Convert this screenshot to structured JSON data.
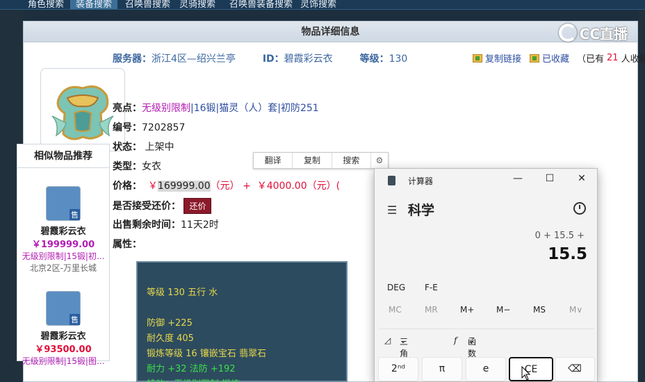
{
  "nav": {
    "tabs": [
      "角色搜索",
      "装备搜索",
      "召唤兽搜索",
      "灵骑搜索",
      "召唤兽装备搜索",
      "灵饰搜索"
    ],
    "active_index": 1
  },
  "panel": {
    "title": "物品详细信息",
    "logo_text": "CC直播"
  },
  "item": {
    "server_label": "服务器：",
    "server_value": "浙江4区—绍兴兰亭",
    "id_label": "ID：",
    "id_value": "碧霞彩云衣",
    "level_label": "等级：",
    "level_value": "130",
    "copy_link": "复制链接",
    "favorited": "已收藏",
    "fav_prefix": "（已有",
    "fav_count": "21",
    "fav_suffix": "人收藏）",
    "highlight_label": "亮点：",
    "highlight_1": "无级别限制",
    "highlight_2": "|16锻|猫灵（人）套|初防251",
    "serial_label": "编号：",
    "serial_value": "7202857",
    "status_label": "状态：",
    "status_value": "上架中",
    "type_label": "类型：",
    "type_value": "女衣",
    "price_label": "价格：",
    "price_value_selected": "￥169999.00",
    "price_unit": "（元）",
    "price_plus": "+",
    "price_extra": "￥4000.00（元）(",
    "bargain_label": "是否接受还价：",
    "bargain_button": "还价",
    "remaining_label": "出售剩余时间：",
    "remaining_value": "11天2时",
    "attr_label": "属性："
  },
  "context_menu": {
    "translate": "翻译",
    "copy": "复制",
    "search": "搜索"
  },
  "attributes": {
    "line1": "等级 130  五行 水",
    "line2": "防御 +225",
    "line3": "耐久度 405",
    "line4": "锻炼等级 16  镶嵌宝石 翡翠石",
    "line5": "耐力 +32  法防 +192",
    "line6": "特效：无级别限制  锻炼..."
  },
  "sidebar": {
    "title": "相似物品推荐",
    "sale_badge": "售",
    "items": [
      {
        "name": "碧霞彩云衣",
        "price": "￥199999.00",
        "tags": "无级别限制|15锻|初...",
        "server": "北京2区-万里长城"
      },
      {
        "name": "碧霞彩云衣",
        "price": "￥93500.00",
        "tags": "无级别限制|15锻|图..."
      }
    ]
  },
  "calculator": {
    "title": "计算器",
    "mode": "科学",
    "expression": "0 + 15.5 +",
    "display": "15.5",
    "deg": "DEG",
    "fe": "F-E",
    "memory": [
      "MC",
      "MR",
      "M+",
      "M−",
      "MS",
      "M∨"
    ],
    "trig": "三角学",
    "func": "函数",
    "keys": [
      "2ⁿᵈ",
      "π",
      "e",
      "CE",
      "⌫"
    ]
  },
  "colors": {
    "accent_purple": "#b41db4",
    "price_red": "#e0103a",
    "bargain_bg": "#8b1a2a",
    "attr_bg": "#2d4b5f",
    "attr_yellow": "#e6d84a",
    "attr_green": "#3be04a"
  }
}
